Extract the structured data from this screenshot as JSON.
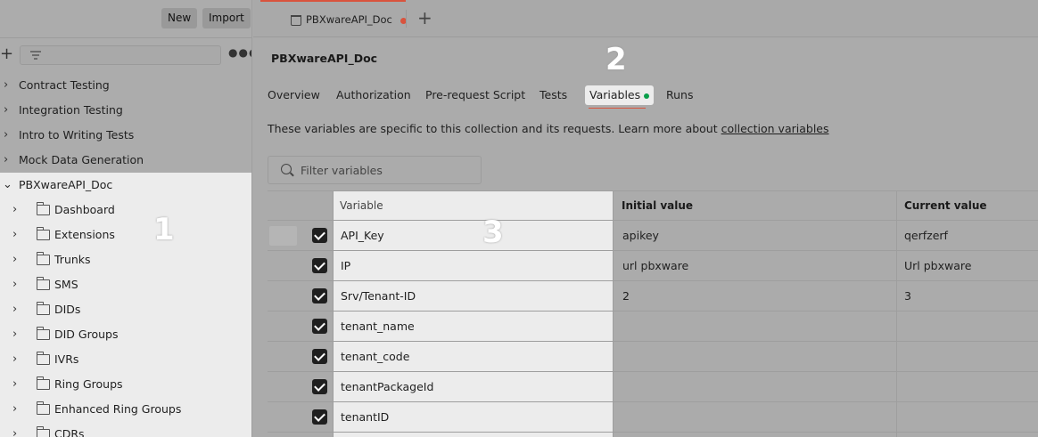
{
  "sidebar": {
    "new_label": "New",
    "import_label": "Import",
    "collections": [
      {
        "label": "Contract Testing"
      },
      {
        "label": "Integration Testing"
      },
      {
        "label": "Intro to Writing Tests"
      },
      {
        "label": "Mock Data Generation"
      }
    ],
    "open_collection": {
      "label": "PBXwareAPI_Doc",
      "folders": [
        {
          "label": "Dashboard"
        },
        {
          "label": "Extensions"
        },
        {
          "label": "Trunks"
        },
        {
          "label": "SMS"
        },
        {
          "label": "DIDs"
        },
        {
          "label": "DID Groups"
        },
        {
          "label": "IVRs"
        },
        {
          "label": "Ring Groups"
        },
        {
          "label": "Enhanced Ring Groups"
        },
        {
          "label": "CDRs"
        }
      ]
    }
  },
  "markers": {
    "one": "1",
    "two": "2",
    "three": "3"
  },
  "tab": {
    "label": "PBXwareAPI_Doc"
  },
  "collection_title": "PBXwareAPI_Doc",
  "subtabs": {
    "overview": "Overview",
    "authorization": "Authorization",
    "prerequest": "Pre-request Script",
    "tests": "Tests",
    "variables": "Variables",
    "runs": "Runs"
  },
  "description": {
    "text": "These variables are specific to this collection and its requests. Learn more about ",
    "link": "collection variables"
  },
  "filter": {
    "placeholder": "Filter variables"
  },
  "table": {
    "headers": {
      "variable": "Variable",
      "initial": "Initial value",
      "current": "Current value"
    },
    "rows": [
      {
        "variable": "API_Key",
        "initial": "apikey",
        "current": "qerfzerf"
      },
      {
        "variable": "IP",
        "initial": "url pbxware",
        "current": "Url pbxware"
      },
      {
        "variable": "Srv/Tenant-ID",
        "initial": "2",
        "current": "3"
      },
      {
        "variable": "tenant_name",
        "initial": "",
        "current": ""
      },
      {
        "variable": "tenant_code",
        "initial": "",
        "current": ""
      },
      {
        "variable": "tenantPackageId",
        "initial": "",
        "current": ""
      },
      {
        "variable": "tenantID",
        "initial": "",
        "current": ""
      }
    ]
  },
  "colors": {
    "accent": "#d9533d",
    "active_dot": "#0a9f4a",
    "highlight": "#ececec",
    "dim_overlay": "#ababab"
  }
}
